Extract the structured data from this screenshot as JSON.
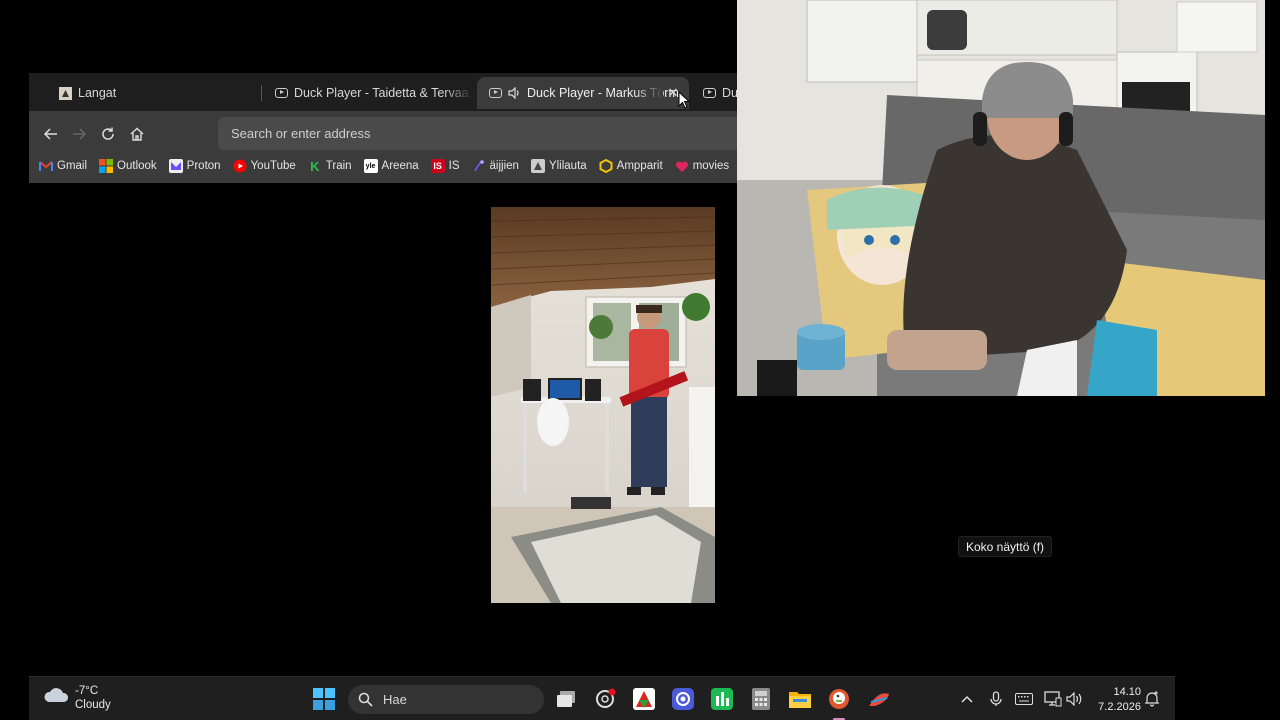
{
  "browser": {
    "tabs": [
      {
        "label": "Langat",
        "icon": "thread-icon",
        "active": false
      },
      {
        "label": "Duck Player - Taidetta & Tervaa, Ca",
        "icon": "video-icon",
        "active": false
      },
      {
        "label": "Duck Player - Markus Törm",
        "icon": "video-icon",
        "audio": true,
        "active": true
      },
      {
        "label": "Duc",
        "icon": "video-icon",
        "active": false
      }
    ],
    "address_placeholder": "Search or enter address",
    "bookmarks": [
      {
        "label": "Gmail",
        "icon": "gmail-icon",
        "color": "#ea4335"
      },
      {
        "label": "Outlook",
        "icon": "outlook-icon",
        "color": "#0078d4"
      },
      {
        "label": "Proton",
        "icon": "proton-icon",
        "color": "#6d4aff"
      },
      {
        "label": "YouTube",
        "icon": "youtube-icon",
        "color": "#ff0000"
      },
      {
        "label": "Train",
        "icon": "train-icon",
        "color": "#2dbe4d"
      },
      {
        "label": "Areena",
        "icon": "areena-icon",
        "color": "#ffffff"
      },
      {
        "label": "IS",
        "icon": "is-icon",
        "color": "#d0021b"
      },
      {
        "label": "äijjien",
        "icon": "aijjien-icon",
        "color": "#7a5cff"
      },
      {
        "label": "Ylilauta",
        "icon": "ylilauta-icon",
        "color": "#888888"
      },
      {
        "label": "Ampparit",
        "icon": "ampparit-icon",
        "color": "#f5c400"
      },
      {
        "label": "movies",
        "icon": "heart-icon",
        "color": "#e0245e"
      }
    ]
  },
  "tooltip": "Koko näyttö (f)",
  "taskbar": {
    "weather_temp": "-7°C",
    "weather_desc": "Cloudy",
    "search_placeholder": "Hae",
    "time": "14.10",
    "date": "7.2.2026"
  }
}
